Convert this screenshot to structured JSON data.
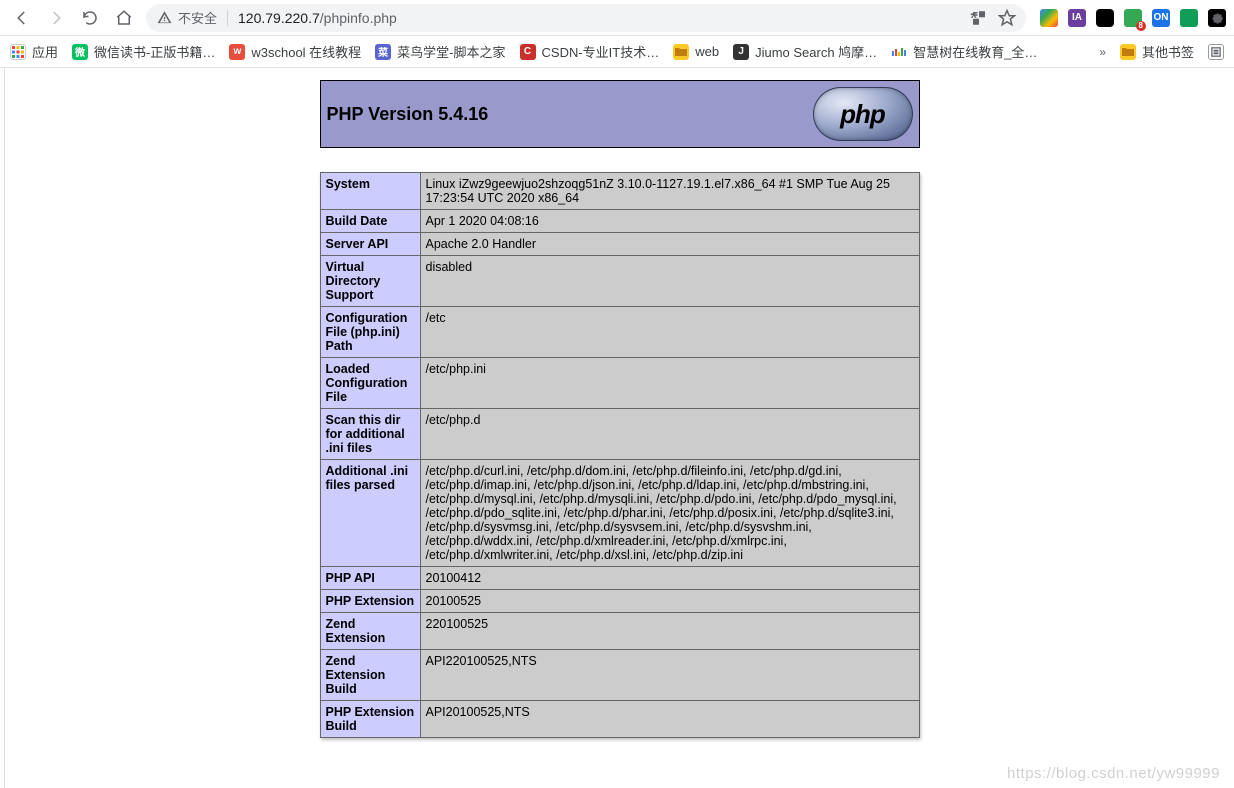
{
  "toolbar": {
    "insecure_label": "不安全",
    "url_host": "120.79.220.7",
    "url_path": "/phpinfo.php"
  },
  "bookmarks": {
    "apps": "应用",
    "items": [
      {
        "label": "微信读书-正版书籍…",
        "color": "#07c160"
      },
      {
        "label": "w3school 在线教程",
        "color": "#e84c3d"
      },
      {
        "label": "菜鸟学堂-脚本之家",
        "color": "#5864d4"
      },
      {
        "label": "CSDN-专业IT技术…",
        "color": "#c9302c"
      },
      {
        "label": "web",
        "color": "folder"
      },
      {
        "label": "Jiumo Search 鸠摩…",
        "color": "#333333"
      },
      {
        "label": "智慧树在线教育_全…",
        "color": "multicolor"
      }
    ],
    "overflow_label": "»",
    "other": "其他书签",
    "reading_list_icon": "reading-list"
  },
  "phpinfo": {
    "title": "PHP Version 5.4.16",
    "rows": [
      {
        "k": "System",
        "v": "Linux iZwz9geewjuo2shzoqg51nZ 3.10.0-1127.19.1.el7.x86_64 #1 SMP Tue Aug 25 17:23:54 UTC 2020 x86_64"
      },
      {
        "k": "Build Date",
        "v": "Apr 1 2020 04:08:16"
      },
      {
        "k": "Server API",
        "v": "Apache 2.0 Handler"
      },
      {
        "k": "Virtual Directory Support",
        "v": "disabled"
      },
      {
        "k": "Configuration File (php.ini) Path",
        "v": "/etc"
      },
      {
        "k": "Loaded Configuration File",
        "v": "/etc/php.ini"
      },
      {
        "k": "Scan this dir for additional .ini files",
        "v": "/etc/php.d"
      },
      {
        "k": "Additional .ini files parsed",
        "v": "/etc/php.d/curl.ini, /etc/php.d/dom.ini, /etc/php.d/fileinfo.ini, /etc/php.d/gd.ini, /etc/php.d/imap.ini, /etc/php.d/json.ini, /etc/php.d/ldap.ini, /etc/php.d/mbstring.ini, /etc/php.d/mysql.ini, /etc/php.d/mysqli.ini, /etc/php.d/pdo.ini, /etc/php.d/pdo_mysql.ini, /etc/php.d/pdo_sqlite.ini, /etc/php.d/phar.ini, /etc/php.d/posix.ini, /etc/php.d/sqlite3.ini, /etc/php.d/sysvmsg.ini, /etc/php.d/sysvsem.ini, /etc/php.d/sysvshm.ini, /etc/php.d/wddx.ini, /etc/php.d/xmlreader.ini, /etc/php.d/xmlrpc.ini, /etc/php.d/xmlwriter.ini, /etc/php.d/xsl.ini, /etc/php.d/zip.ini"
      },
      {
        "k": "PHP API",
        "v": "20100412"
      },
      {
        "k": "PHP Extension",
        "v": "20100525"
      },
      {
        "k": "Zend Extension",
        "v": "220100525"
      },
      {
        "k": "Zend Extension Build",
        "v": "API220100525,NTS"
      },
      {
        "k": "PHP Extension Build",
        "v": "API20100525,NTS"
      }
    ]
  },
  "watermark": "https://blog.csdn.net/yw99999",
  "ext_badge": "8"
}
